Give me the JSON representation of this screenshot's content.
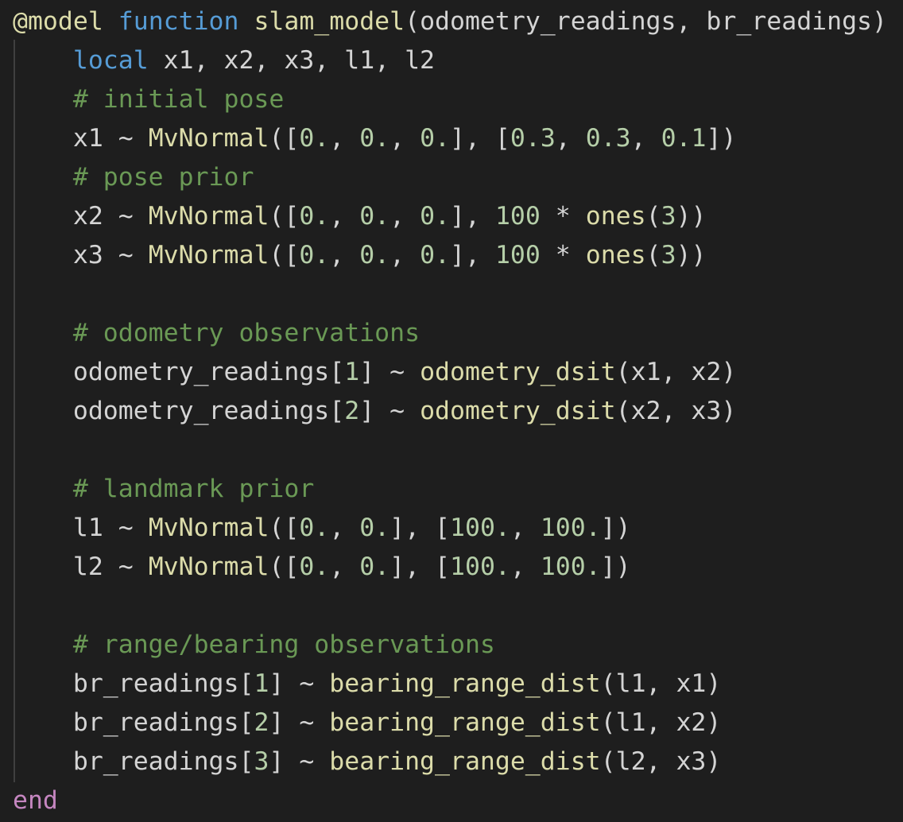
{
  "code": {
    "lines": [
      [
        {
          "t": "@model",
          "c": "macro"
        },
        {
          "t": " ",
          "c": "txt"
        },
        {
          "t": "function",
          "c": "kw"
        },
        {
          "t": " ",
          "c": "txt"
        },
        {
          "t": "slam_model",
          "c": "fn"
        },
        {
          "t": "(odometry_readings, br_readings)",
          "c": "txt"
        }
      ],
      [
        {
          "t": "    ",
          "c": "txt"
        },
        {
          "t": "local",
          "c": "kw"
        },
        {
          "t": " x1, x2, x3, l1, l2",
          "c": "txt"
        }
      ],
      [
        {
          "t": "    ",
          "c": "txt"
        },
        {
          "t": "# initial pose",
          "c": "cm"
        }
      ],
      [
        {
          "t": "    x1 ~ ",
          "c": "txt"
        },
        {
          "t": "MvNormal",
          "c": "fn"
        },
        {
          "t": "([",
          "c": "txt"
        },
        {
          "t": "0.",
          "c": "num"
        },
        {
          "t": ", ",
          "c": "txt"
        },
        {
          "t": "0.",
          "c": "num"
        },
        {
          "t": ", ",
          "c": "txt"
        },
        {
          "t": "0.",
          "c": "num"
        },
        {
          "t": "], [",
          "c": "txt"
        },
        {
          "t": "0.3",
          "c": "num"
        },
        {
          "t": ", ",
          "c": "txt"
        },
        {
          "t": "0.3",
          "c": "num"
        },
        {
          "t": ", ",
          "c": "txt"
        },
        {
          "t": "0.1",
          "c": "num"
        },
        {
          "t": "])",
          "c": "txt"
        }
      ],
      [
        {
          "t": "    ",
          "c": "txt"
        },
        {
          "t": "# pose prior",
          "c": "cm"
        }
      ],
      [
        {
          "t": "    x2 ~ ",
          "c": "txt"
        },
        {
          "t": "MvNormal",
          "c": "fn"
        },
        {
          "t": "([",
          "c": "txt"
        },
        {
          "t": "0.",
          "c": "num"
        },
        {
          "t": ", ",
          "c": "txt"
        },
        {
          "t": "0.",
          "c": "num"
        },
        {
          "t": ", ",
          "c": "txt"
        },
        {
          "t": "0.",
          "c": "num"
        },
        {
          "t": "], ",
          "c": "txt"
        },
        {
          "t": "100",
          "c": "num"
        },
        {
          "t": " * ",
          "c": "txt"
        },
        {
          "t": "ones",
          "c": "fn"
        },
        {
          "t": "(",
          "c": "txt"
        },
        {
          "t": "3",
          "c": "num"
        },
        {
          "t": "))",
          "c": "txt"
        }
      ],
      [
        {
          "t": "    x3 ~ ",
          "c": "txt"
        },
        {
          "t": "MvNormal",
          "c": "fn"
        },
        {
          "t": "([",
          "c": "txt"
        },
        {
          "t": "0.",
          "c": "num"
        },
        {
          "t": ", ",
          "c": "txt"
        },
        {
          "t": "0.",
          "c": "num"
        },
        {
          "t": ", ",
          "c": "txt"
        },
        {
          "t": "0.",
          "c": "num"
        },
        {
          "t": "], ",
          "c": "txt"
        },
        {
          "t": "100",
          "c": "num"
        },
        {
          "t": " * ",
          "c": "txt"
        },
        {
          "t": "ones",
          "c": "fn"
        },
        {
          "t": "(",
          "c": "txt"
        },
        {
          "t": "3",
          "c": "num"
        },
        {
          "t": "))",
          "c": "txt"
        }
      ],
      [],
      [
        {
          "t": "    ",
          "c": "txt"
        },
        {
          "t": "# odometry observations",
          "c": "cm"
        }
      ],
      [
        {
          "t": "    odometry_readings[",
          "c": "txt"
        },
        {
          "t": "1",
          "c": "num"
        },
        {
          "t": "] ~ ",
          "c": "txt"
        },
        {
          "t": "odometry_dsit",
          "c": "fn"
        },
        {
          "t": "(x1, x2)",
          "c": "txt"
        }
      ],
      [
        {
          "t": "    odometry_readings[",
          "c": "txt"
        },
        {
          "t": "2",
          "c": "num"
        },
        {
          "t": "] ~ ",
          "c": "txt"
        },
        {
          "t": "odometry_dsit",
          "c": "fn"
        },
        {
          "t": "(x2, x3)",
          "c": "txt"
        }
      ],
      [],
      [
        {
          "t": "    ",
          "c": "txt"
        },
        {
          "t": "# landmark prior",
          "c": "cm"
        }
      ],
      [
        {
          "t": "    l1 ~ ",
          "c": "txt"
        },
        {
          "t": "MvNormal",
          "c": "fn"
        },
        {
          "t": "([",
          "c": "txt"
        },
        {
          "t": "0.",
          "c": "num"
        },
        {
          "t": ", ",
          "c": "txt"
        },
        {
          "t": "0.",
          "c": "num"
        },
        {
          "t": "], [",
          "c": "txt"
        },
        {
          "t": "100.",
          "c": "num"
        },
        {
          "t": ", ",
          "c": "txt"
        },
        {
          "t": "100.",
          "c": "num"
        },
        {
          "t": "])",
          "c": "txt"
        }
      ],
      [
        {
          "t": "    l2 ~ ",
          "c": "txt"
        },
        {
          "t": "MvNormal",
          "c": "fn"
        },
        {
          "t": "([",
          "c": "txt"
        },
        {
          "t": "0.",
          "c": "num"
        },
        {
          "t": ", ",
          "c": "txt"
        },
        {
          "t": "0.",
          "c": "num"
        },
        {
          "t": "], [",
          "c": "txt"
        },
        {
          "t": "100.",
          "c": "num"
        },
        {
          "t": ", ",
          "c": "txt"
        },
        {
          "t": "100.",
          "c": "num"
        },
        {
          "t": "])",
          "c": "txt"
        }
      ],
      [],
      [
        {
          "t": "    ",
          "c": "txt"
        },
        {
          "t": "# range/bearing observations",
          "c": "cm"
        }
      ],
      [
        {
          "t": "    br_readings[",
          "c": "txt"
        },
        {
          "t": "1",
          "c": "num"
        },
        {
          "t": "] ~ ",
          "c": "txt"
        },
        {
          "t": "bearing_range_dist",
          "c": "fn"
        },
        {
          "t": "(l1, x1)",
          "c": "txt"
        }
      ],
      [
        {
          "t": "    br_readings[",
          "c": "txt"
        },
        {
          "t": "2",
          "c": "num"
        },
        {
          "t": "] ~ ",
          "c": "txt"
        },
        {
          "t": "bearing_range_dist",
          "c": "fn"
        },
        {
          "t": "(l1, x2)",
          "c": "txt"
        }
      ],
      [
        {
          "t": "    br_readings[",
          "c": "txt"
        },
        {
          "t": "3",
          "c": "num"
        },
        {
          "t": "] ~ ",
          "c": "txt"
        },
        {
          "t": "bearing_range_dist",
          "c": "fn"
        },
        {
          "t": "(l2, x3)",
          "c": "txt"
        }
      ],
      [
        {
          "t": "end",
          "c": "ctrl"
        }
      ]
    ]
  },
  "theme": {
    "background": "#1e1e1e",
    "keyword": "#569cd6",
    "control": "#c586c0",
    "function": "#dcdcaa",
    "number": "#b5cea8",
    "comment": "#6a9955",
    "text": "#d4d4d4",
    "indent_guide": "#404040"
  }
}
